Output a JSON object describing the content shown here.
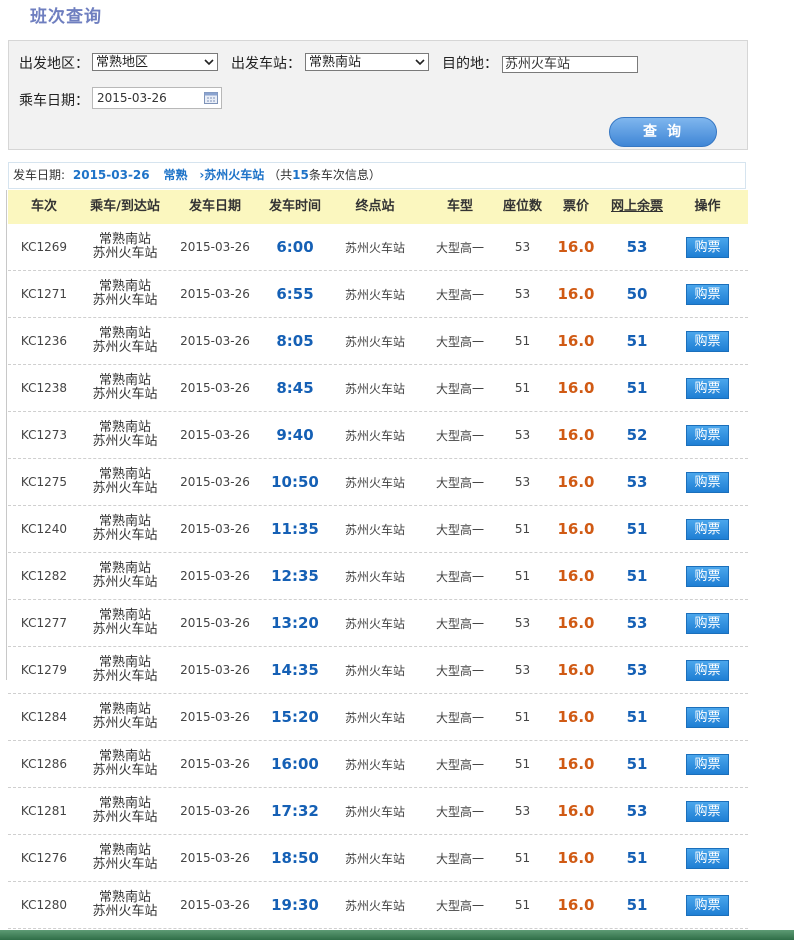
{
  "page": {
    "title": "班次查询"
  },
  "search": {
    "region_label": "出发地区：",
    "region_value": "常熟地区",
    "station_label": "出发车站：",
    "station_value": "常熟南站",
    "dest_label": "目的地：",
    "dest_value": "苏州火车站",
    "date_label": "乘车日期：",
    "date_value": "2015-03-26",
    "button_label": "查询"
  },
  "info": {
    "date_prefix": "发车日期:",
    "date": "2015-03-26",
    "from": "常熟",
    "to": "苏州火车站",
    "count_prefix": "（共",
    "count": "15",
    "count_suffix": "条车次信息）"
  },
  "table": {
    "headers": [
      "车次",
      "乘车/到达站",
      "发车日期",
      "发车时间",
      "终点站",
      "车型",
      "座位数",
      "票价",
      "网上余票",
      "操作"
    ],
    "buy_label": "购票",
    "rows": [
      {
        "code": "KC1269",
        "board": "常熟南站",
        "arrive": "苏州火车站",
        "date": "2015-03-26",
        "time": "6:00",
        "terminal": "苏州火车站",
        "type": "大型高一",
        "seats": "53",
        "price": "16.0",
        "left": "53"
      },
      {
        "code": "KC1271",
        "board": "常熟南站",
        "arrive": "苏州火车站",
        "date": "2015-03-26",
        "time": "6:55",
        "terminal": "苏州火车站",
        "type": "大型高一",
        "seats": "53",
        "price": "16.0",
        "left": "50"
      },
      {
        "code": "KC1236",
        "board": "常熟南站",
        "arrive": "苏州火车站",
        "date": "2015-03-26",
        "time": "8:05",
        "terminal": "苏州火车站",
        "type": "大型高一",
        "seats": "51",
        "price": "16.0",
        "left": "51"
      },
      {
        "code": "KC1238",
        "board": "常熟南站",
        "arrive": "苏州火车站",
        "date": "2015-03-26",
        "time": "8:45",
        "terminal": "苏州火车站",
        "type": "大型高一",
        "seats": "51",
        "price": "16.0",
        "left": "51"
      },
      {
        "code": "KC1273",
        "board": "常熟南站",
        "arrive": "苏州火车站",
        "date": "2015-03-26",
        "time": "9:40",
        "terminal": "苏州火车站",
        "type": "大型高一",
        "seats": "53",
        "price": "16.0",
        "left": "52"
      },
      {
        "code": "KC1275",
        "board": "常熟南站",
        "arrive": "苏州火车站",
        "date": "2015-03-26",
        "time": "10:50",
        "terminal": "苏州火车站",
        "type": "大型高一",
        "seats": "53",
        "price": "16.0",
        "left": "53"
      },
      {
        "code": "KC1240",
        "board": "常熟南站",
        "arrive": "苏州火车站",
        "date": "2015-03-26",
        "time": "11:35",
        "terminal": "苏州火车站",
        "type": "大型高一",
        "seats": "51",
        "price": "16.0",
        "left": "51"
      },
      {
        "code": "KC1282",
        "board": "常熟南站",
        "arrive": "苏州火车站",
        "date": "2015-03-26",
        "time": "12:35",
        "terminal": "苏州火车站",
        "type": "大型高一",
        "seats": "51",
        "price": "16.0",
        "left": "51"
      },
      {
        "code": "KC1277",
        "board": "常熟南站",
        "arrive": "苏州火车站",
        "date": "2015-03-26",
        "time": "13:20",
        "terminal": "苏州火车站",
        "type": "大型高一",
        "seats": "53",
        "price": "16.0",
        "left": "53"
      },
      {
        "code": "KC1279",
        "board": "常熟南站",
        "arrive": "苏州火车站",
        "date": "2015-03-26",
        "time": "14:35",
        "terminal": "苏州火车站",
        "type": "大型高一",
        "seats": "53",
        "price": "16.0",
        "left": "53"
      },
      {
        "code": "KC1284",
        "board": "常熟南站",
        "arrive": "苏州火车站",
        "date": "2015-03-26",
        "time": "15:20",
        "terminal": "苏州火车站",
        "type": "大型高一",
        "seats": "51",
        "price": "16.0",
        "left": "51"
      },
      {
        "code": "KC1286",
        "board": "常熟南站",
        "arrive": "苏州火车站",
        "date": "2015-03-26",
        "time": "16:00",
        "terminal": "苏州火车站",
        "type": "大型高一",
        "seats": "51",
        "price": "16.0",
        "left": "51"
      },
      {
        "code": "KC1281",
        "board": "常熟南站",
        "arrive": "苏州火车站",
        "date": "2015-03-26",
        "time": "17:32",
        "terminal": "苏州火车站",
        "type": "大型高一",
        "seats": "53",
        "price": "16.0",
        "left": "53"
      },
      {
        "code": "KC1276",
        "board": "常熟南站",
        "arrive": "苏州火车站",
        "date": "2015-03-26",
        "time": "18:50",
        "terminal": "苏州火车站",
        "type": "大型高一",
        "seats": "51",
        "price": "16.0",
        "left": "51"
      },
      {
        "code": "KC1280",
        "board": "常熟南站",
        "arrive": "苏州火车站",
        "date": "2015-03-26",
        "time": "19:30",
        "terminal": "苏州火车站",
        "type": "大型高一",
        "seats": "51",
        "price": "16.0",
        "left": "51"
      }
    ]
  },
  "colors": {
    "header_bg": "#fbf7bf",
    "time": "#1560b5",
    "price": "#d05a14",
    "button": "#2a8ad8"
  }
}
